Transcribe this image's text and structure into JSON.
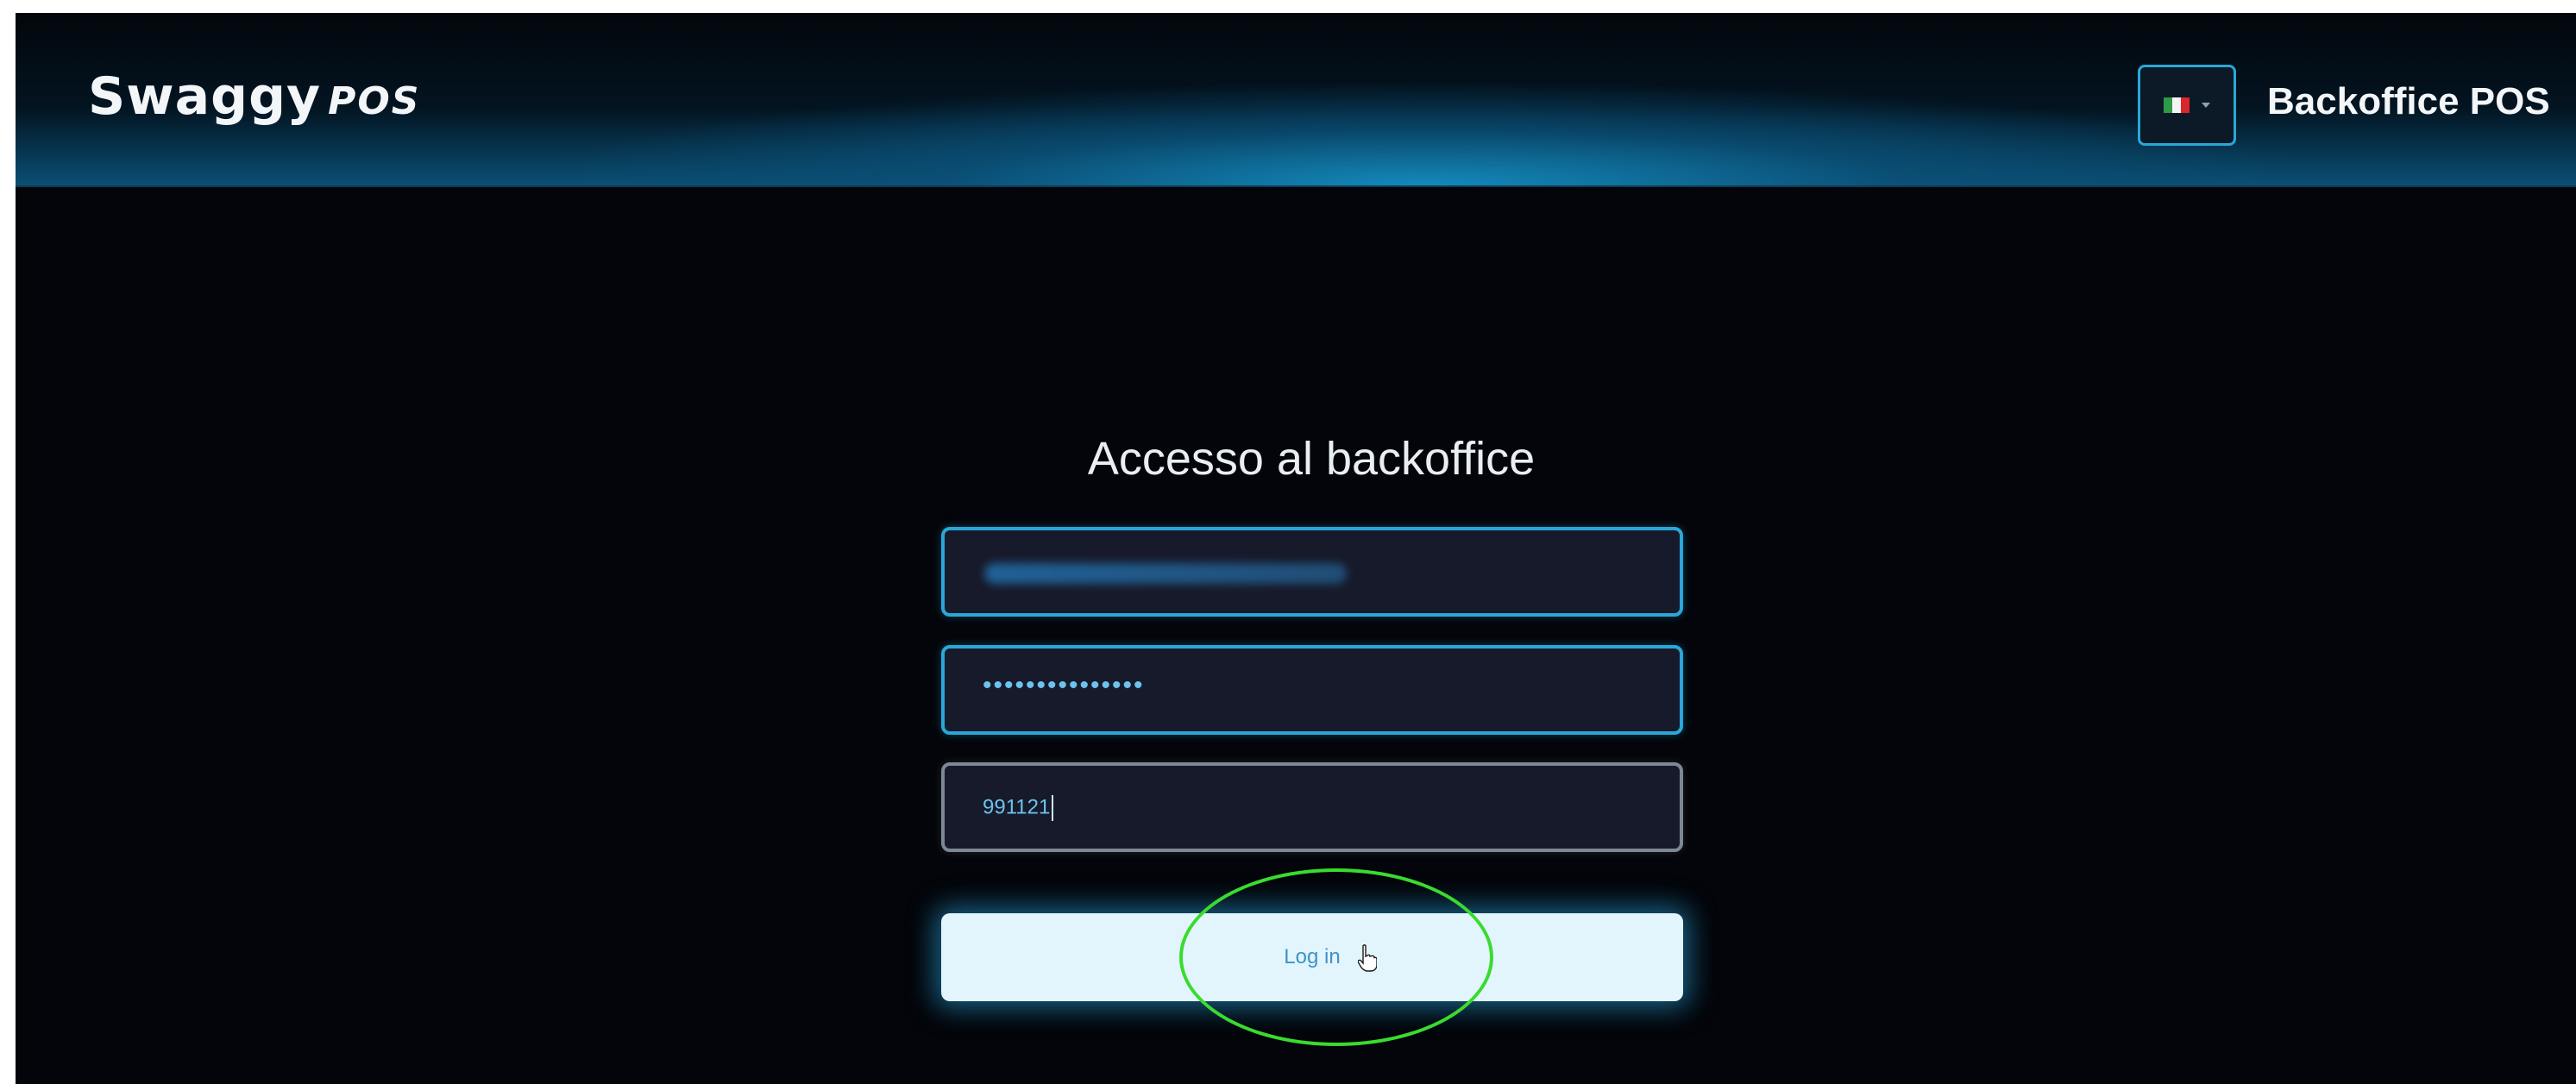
{
  "header": {
    "logo_main": "Swaggy",
    "logo_suffix": "POS",
    "app_title": "Backoffice POS",
    "language": {
      "selected": "Italiano",
      "flag_colors": [
        "#2e9a45",
        "#f4f4f4",
        "#d9272e"
      ]
    }
  },
  "login": {
    "heading": "Accesso al backoffice",
    "password_masked": "•••••••••••••••",
    "code_value": "991121",
    "button_label": "Log in"
  },
  "colors": {
    "accent": "#2aa7d8",
    "background": "#03050a",
    "highlight": "#3adb2f"
  },
  "icons": [
    "flag-italy-icon",
    "chevron-down-icon",
    "hand-pointer-icon"
  ]
}
